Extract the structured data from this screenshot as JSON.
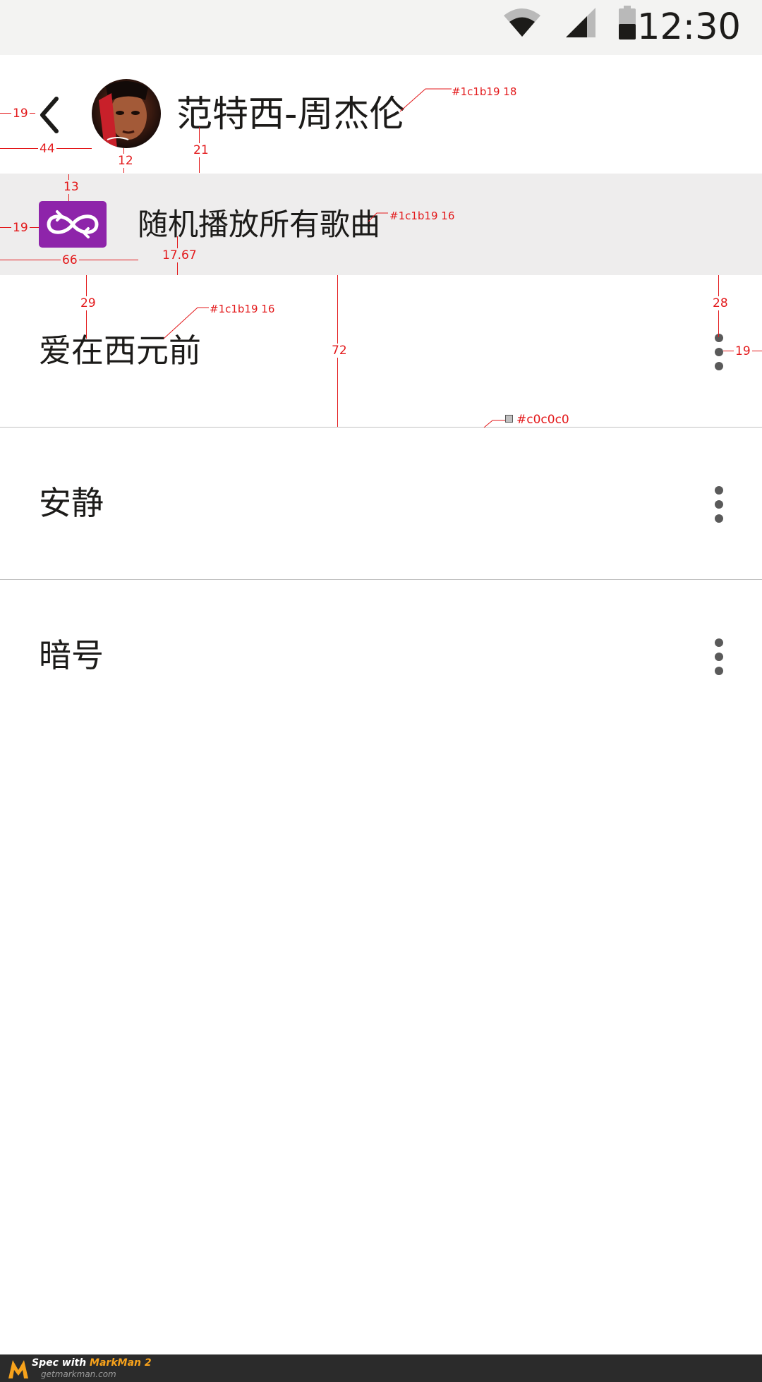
{
  "status_bar": {
    "time": "12:30",
    "icons": [
      "wifi-icon",
      "cell-signal-icon",
      "battery-icon"
    ]
  },
  "header": {
    "title": "范特西-周杰伦",
    "back_icon": "chevron-left-icon",
    "avatar": "album-cover"
  },
  "shuffle": {
    "label": "随机播放所有歌曲",
    "icon": "shuffle-infinity-icon",
    "icon_color": "#8e24aa"
  },
  "songs": [
    {
      "title": "爱在西元前"
    },
    {
      "title": "安静"
    },
    {
      "title": "暗号"
    }
  ],
  "annotations": {
    "title_color": "#1c1b19 18",
    "shuffle_color": "#1c1b19 16",
    "song_color": "#1c1b19 16",
    "divider_color": "#c0c0c0",
    "dims": [
      "19",
      "44",
      "12",
      "21",
      "13",
      "19",
      "66",
      "17.67",
      "29",
      "72",
      "28",
      "19"
    ]
  },
  "footer": {
    "prefix": "Spec with ",
    "brand": "MarkMan 2",
    "site": "getmarkman.com"
  },
  "colors": {
    "text": "#1c1b19",
    "divider": "#c0c0c0",
    "accent": "#8e24aa",
    "spec_red": "#e3191b"
  }
}
